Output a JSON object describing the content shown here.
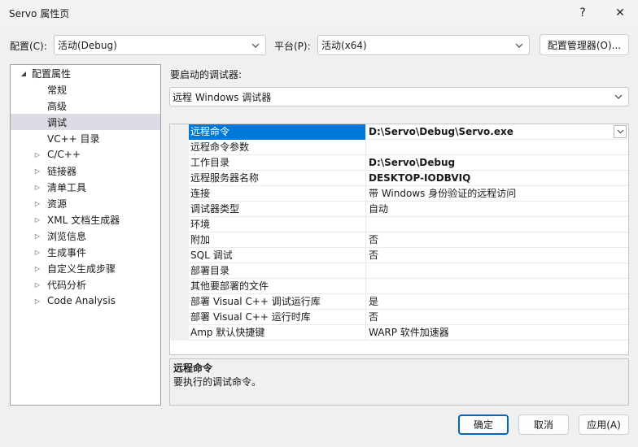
{
  "window": {
    "title": "Servo 属性页",
    "help_label": "?",
    "close_label": "✕"
  },
  "config": {
    "config_label": "配置(C):",
    "config_value": "活动(Debug)",
    "platform_label": "平台(P):",
    "platform_value": "活动(x64)",
    "manager_button": "配置管理器(O)..."
  },
  "tree": {
    "items": [
      {
        "label": "配置属性",
        "expander": "◢",
        "level": 0
      },
      {
        "label": "常规",
        "expander": "",
        "level": 1
      },
      {
        "label": "高级",
        "expander": "",
        "level": 1
      },
      {
        "label": "调试",
        "expander": "",
        "level": 1,
        "selected": true
      },
      {
        "label": "VC++ 目录",
        "expander": "",
        "level": 1
      },
      {
        "label": "C/C++",
        "expander": "▷",
        "level": 1
      },
      {
        "label": "链接器",
        "expander": "▷",
        "level": 1
      },
      {
        "label": "清单工具",
        "expander": "▷",
        "level": 1
      },
      {
        "label": "资源",
        "expander": "▷",
        "level": 1
      },
      {
        "label": "XML 文档生成器",
        "expander": "▷",
        "level": 1
      },
      {
        "label": "浏览信息",
        "expander": "▷",
        "level": 1
      },
      {
        "label": "生成事件",
        "expander": "▷",
        "level": 1
      },
      {
        "label": "自定义生成步骤",
        "expander": "▷",
        "level": 1
      },
      {
        "label": "代码分析",
        "expander": "▷",
        "level": 1
      },
      {
        "label": "Code Analysis",
        "expander": "▷",
        "level": 1
      }
    ]
  },
  "debugger": {
    "label": "要启动的调试器:",
    "value": "远程 Windows 调试器"
  },
  "properties": [
    {
      "name": "远程命令",
      "value": "D:\\Servo\\Debug\\Servo.exe",
      "bold": true,
      "selected": true
    },
    {
      "name": "远程命令参数",
      "value": "",
      "bold": false
    },
    {
      "name": "工作目录",
      "value": "D:\\Servo\\Debug",
      "bold": true
    },
    {
      "name": "远程服务器名称",
      "value": "DESKTOP-IODBVIQ",
      "bold": true
    },
    {
      "name": "连接",
      "value": "带 Windows 身份验证的远程访问",
      "bold": false
    },
    {
      "name": "调试器类型",
      "value": "自动",
      "bold": false
    },
    {
      "name": "环境",
      "value": "",
      "bold": false
    },
    {
      "name": "附加",
      "value": "否",
      "bold": false
    },
    {
      "name": "SQL 调试",
      "value": "否",
      "bold": false
    },
    {
      "name": "部署目录",
      "value": "",
      "bold": false
    },
    {
      "name": "其他要部署的文件",
      "value": "",
      "bold": false
    },
    {
      "name": "部署 Visual C++ 调试运行库",
      "value": "是",
      "bold": false
    },
    {
      "name": "部署 Visual C++ 运行时库",
      "value": "否",
      "bold": false
    },
    {
      "name": "Amp 默认快捷键",
      "value": "WARP 软件加速器",
      "bold": false
    }
  ],
  "description": {
    "title": "远程命令",
    "text": "要执行的调试命令。"
  },
  "buttons": {
    "ok": "确定",
    "cancel": "取消",
    "apply": "应用(A)"
  },
  "colors": {
    "accent": "#0078d7",
    "tree_selected": "#dcdce4",
    "background": "#f0f0f0"
  }
}
